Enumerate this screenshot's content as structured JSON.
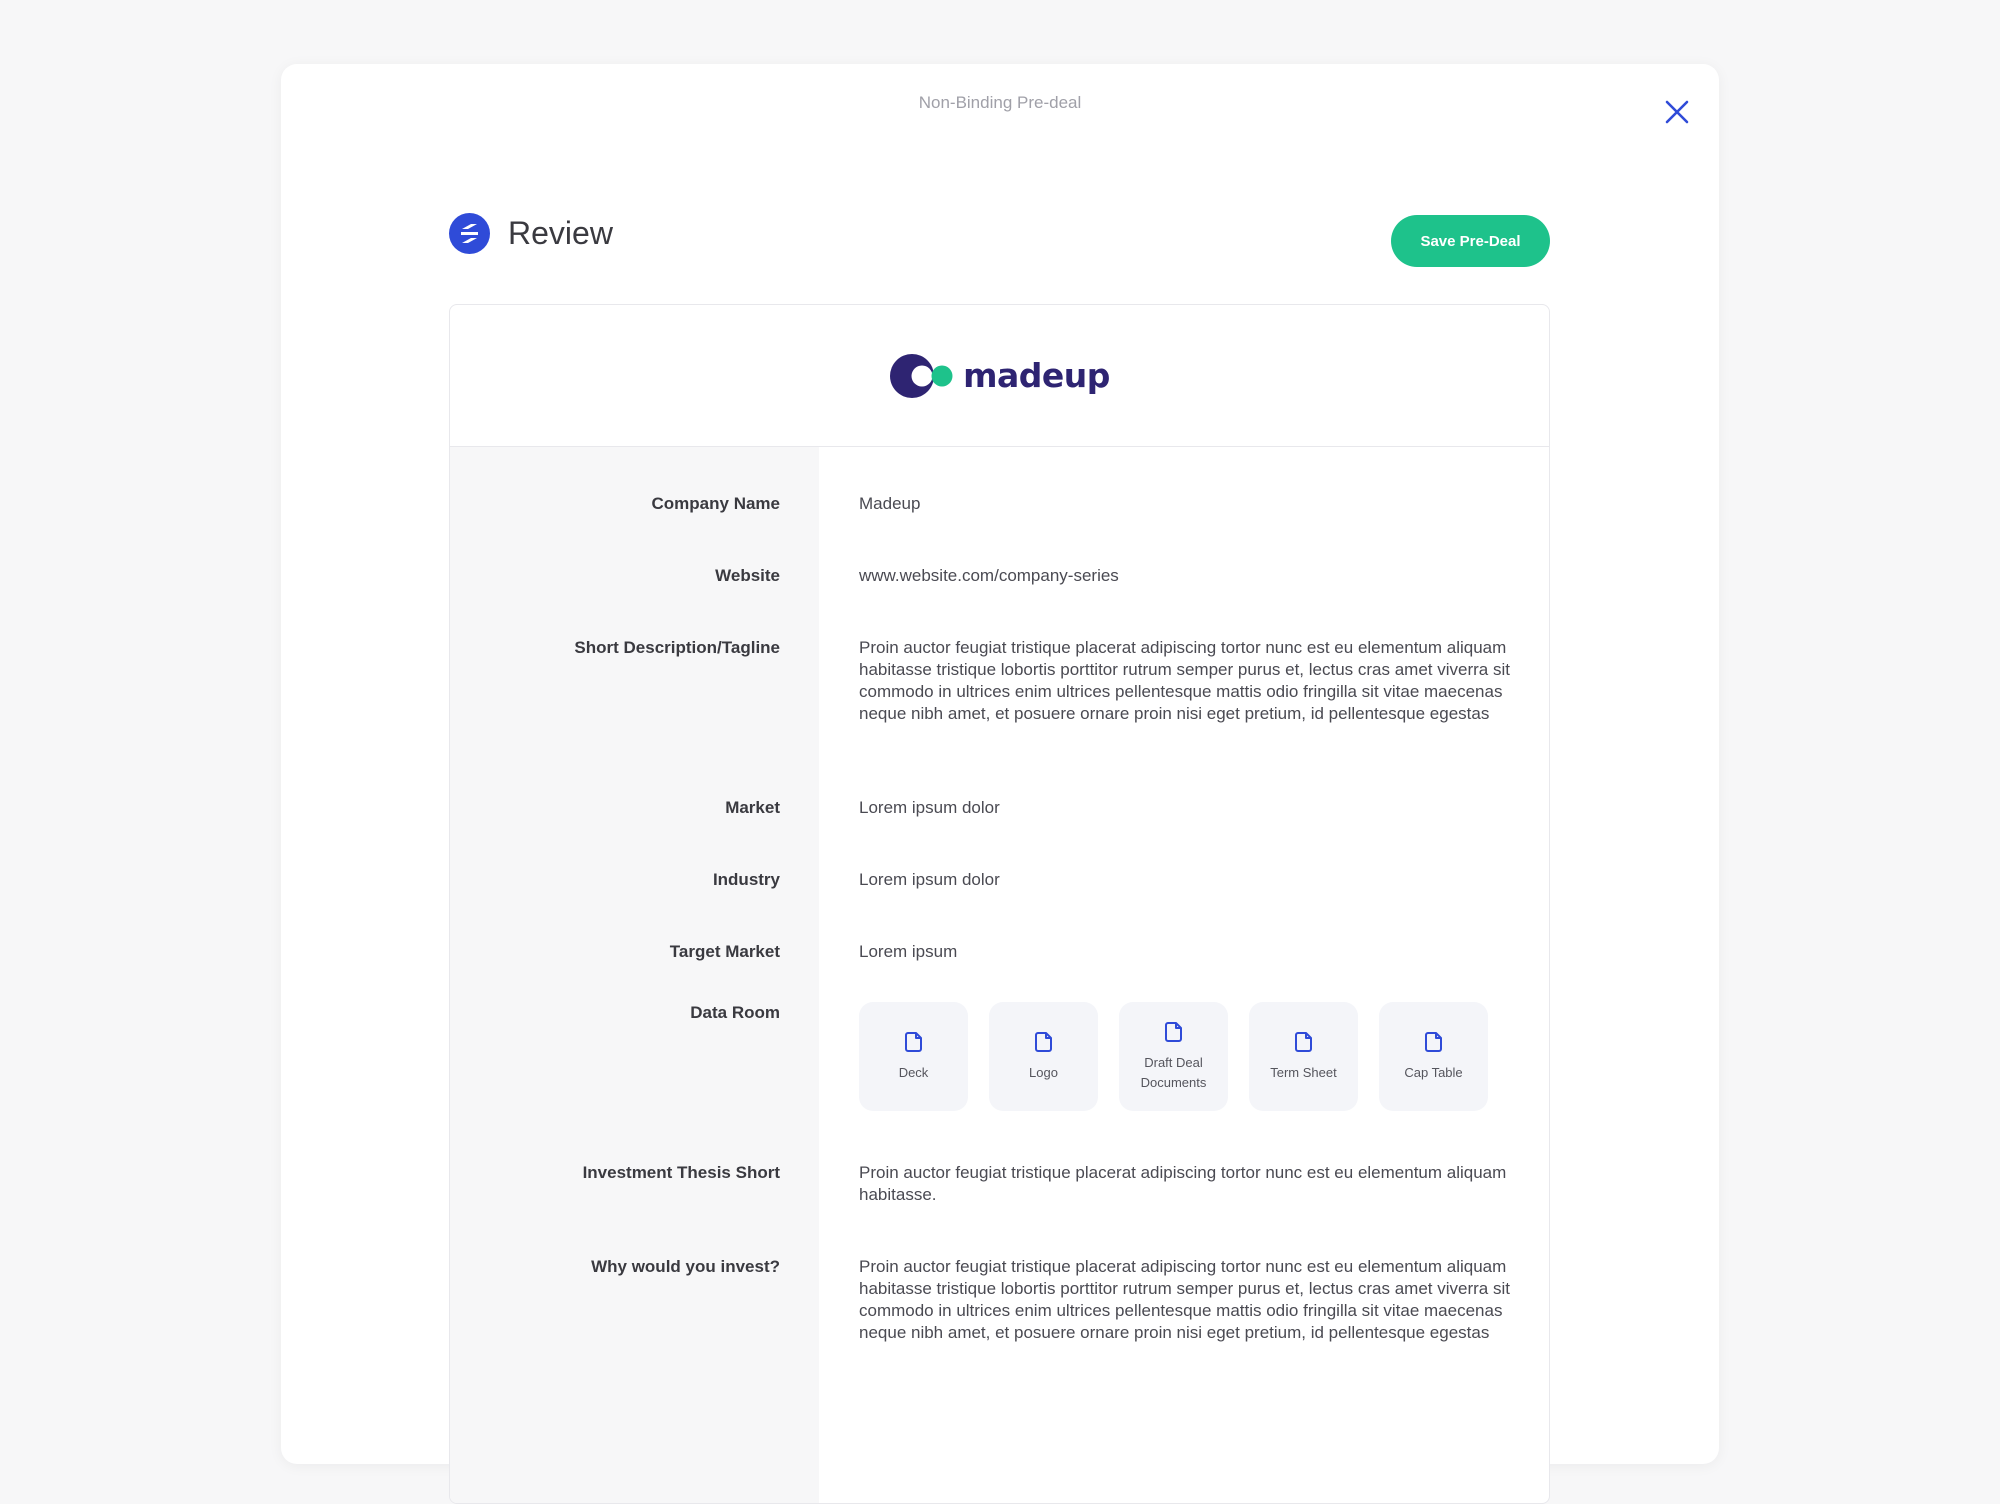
{
  "modal": {
    "title": "Non-Binding Pre-deal",
    "close_icon": "close-icon"
  },
  "header": {
    "title": "Review",
    "save_label": "Save Pre-Deal",
    "brand_icon": "brand-icon"
  },
  "colors": {
    "accent_blue": "#2f4bd8",
    "save_green": "#1ec28b",
    "logo_navy": "#2e2472",
    "logo_teal": "#1ec28b"
  },
  "company_logo": {
    "text": "madeup"
  },
  "fields": {
    "company_name": {
      "label": "Company Name",
      "value": "Madeup"
    },
    "website": {
      "label": "Website",
      "value": "www.website.com/company-series"
    },
    "tagline": {
      "label": "Short Description/Tagline",
      "value": "Proin auctor feugiat tristique placerat adipiscing tortor nunc est eu elementum aliquam habitasse tristique lobortis porttitor rutrum semper purus et, lectus cras amet viverra sit commodo in ultrices enim ultrices pellentesque mattis odio fringilla sit vitae maecenas neque nibh amet, et posuere ornare proin nisi eget pretium, id pellentesque egestas"
    },
    "market": {
      "label": "Market",
      "value": "Lorem ipsum dolor"
    },
    "industry": {
      "label": "Industry",
      "value": "Lorem ipsum dolor"
    },
    "target_market": {
      "label": "Target Market",
      "value": "Lorem ipsum"
    },
    "data_room": {
      "label": "Data Room",
      "files": [
        {
          "label": "Deck",
          "icon": "file-icon"
        },
        {
          "label": "Logo",
          "icon": "file-icon"
        },
        {
          "label": "Draft Deal Documents",
          "icon": "file-icon"
        },
        {
          "label": "Term Sheet",
          "icon": "file-icon"
        },
        {
          "label": "Cap Table",
          "icon": "file-icon"
        }
      ]
    },
    "thesis_short": {
      "label": "Investment Thesis Short",
      "value": "Proin auctor feugiat tristique placerat adipiscing tortor nunc est eu elementum aliquam habitasse."
    },
    "why_invest": {
      "label": "Why would you invest?",
      "value": "Proin auctor feugiat tristique placerat adipiscing tortor nunc est eu elementum aliquam habitasse tristique lobortis porttitor rutrum semper purus et, lectus cras amet viverra sit commodo in ultrices enim ultrices pellentesque mattis odio fringilla sit vitae maecenas neque nibh amet, et posuere ornare proin nisi eget pretium, id pellentesque egestas"
    }
  }
}
